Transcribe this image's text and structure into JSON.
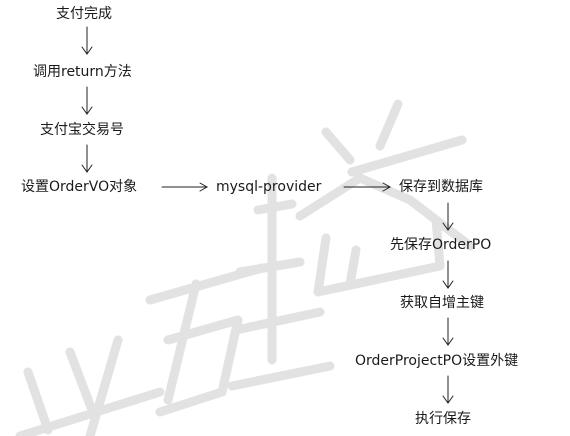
{
  "diagram": {
    "nodes": {
      "pay_done": "支付完成",
      "call_return": "调用return方法",
      "alipay_no": "支付宝交易号",
      "set_ordervo": "设置OrderVO对象",
      "mysql_provider": "mysql-provider",
      "save_db": "保存到数据库",
      "save_orderpo": "先保存OrderPO",
      "get_autoinc": "获取自增主键",
      "set_fk": "OrderProjectPO设置外键",
      "execute_save": "执行保存"
    },
    "edges": [
      {
        "from": "pay_done",
        "to": "call_return"
      },
      {
        "from": "call_return",
        "to": "alipay_no"
      },
      {
        "from": "alipay_no",
        "to": "set_ordervo"
      },
      {
        "from": "set_ordervo",
        "to": "mysql_provider"
      },
      {
        "from": "mysql_provider",
        "to": "save_db"
      },
      {
        "from": "save_db",
        "to": "save_orderpo"
      },
      {
        "from": "save_orderpo",
        "to": "get_autoinc"
      },
      {
        "from": "get_autoinc",
        "to": "set_fk"
      },
      {
        "from": "set_fk",
        "to": "execute_save"
      }
    ]
  },
  "watermark": {
    "text": "尚硅谷",
    "color": "#e2e2e2"
  }
}
